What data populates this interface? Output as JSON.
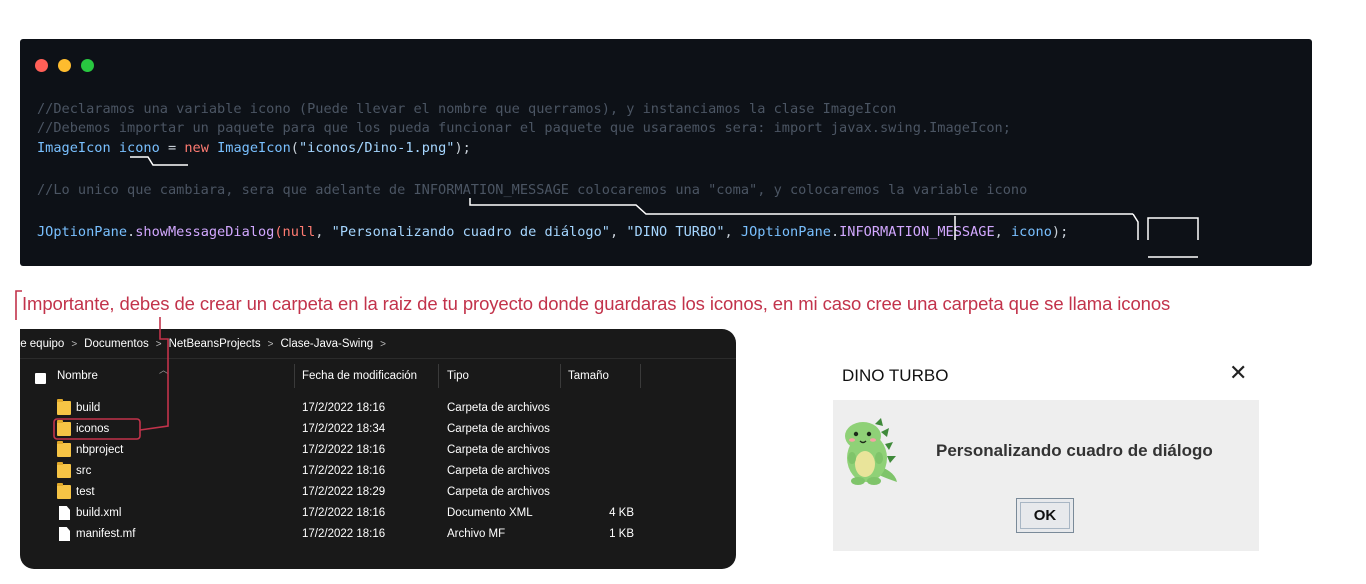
{
  "code": {
    "line1": "//Declaramos una variable icono (Puede llevar el nombre que querramos), y instanciamos la clase ImageIcon",
    "line2": "//Debemos importar un paquete para que los pueda funcionar el paquete que usaraemos sera: import javax.swing.ImageIcon;",
    "line3": {
      "type": "ImageIcon",
      "var": "icono",
      "eq": " = ",
      "kw": "new",
      "ctor": "ImageIcon",
      "open": "(",
      "arg": "\"iconos/Dino-1.png\"",
      "close": ");"
    },
    "line4": "//Lo unico que cambiara, sera que adelante de INFORMATION_MESSAGE colocaremos una \"coma\", y colocaremos la variable icono",
    "line5": {
      "cls": "JOptionPane",
      "dot1": ".",
      "method": "showMessageDialog",
      "open": "(",
      "nul": "null",
      "c1": ", ",
      "msg": "\"Personalizando cuadro de diálogo\"",
      "c2": ", ",
      "title": "\"DINO TURBO\"",
      "c3": ", ",
      "cls2": "JOptionPane",
      "dot2": ".",
      "constant": "INFORMATION_MESSAGE",
      "c4": ", ",
      "icon": "icono",
      "close": ");"
    }
  },
  "note": "Importante, debes de crear un carpeta en la raiz de tu proyecto donde guardaras los iconos, en mi caso cree una carpeta que se llama iconos",
  "explorer": {
    "breadcrumb": [
      "te equipo",
      "Documentos",
      "NetBeansProjects",
      "Clase-Java-Swing"
    ],
    "columns": {
      "name": "Nombre",
      "date": "Fecha de modificación",
      "type": "Tipo",
      "size": "Tamaño"
    },
    "rows": [
      {
        "name": "build",
        "date": "17/2/2022 18:16",
        "type": "Carpeta de archivos",
        "size": "",
        "kind": "folder"
      },
      {
        "name": "iconos",
        "date": "17/2/2022 18:34",
        "type": "Carpeta de archivos",
        "size": "",
        "kind": "folder"
      },
      {
        "name": "nbproject",
        "date": "17/2/2022 18:16",
        "type": "Carpeta de archivos",
        "size": "",
        "kind": "folder"
      },
      {
        "name": "src",
        "date": "17/2/2022 18:16",
        "type": "Carpeta de archivos",
        "size": "",
        "kind": "folder"
      },
      {
        "name": "test",
        "date": "17/2/2022 18:29",
        "type": "Carpeta de archivos",
        "size": "",
        "kind": "folder"
      },
      {
        "name": "build.xml",
        "date": "17/2/2022 18:16",
        "type": "Documento XML",
        "size": "4 KB",
        "kind": "file"
      },
      {
        "name": "manifest.mf",
        "date": "17/2/2022 18:16",
        "type": "Archivo MF",
        "size": "1 KB",
        "kind": "file"
      }
    ]
  },
  "dialog": {
    "title": "DINO TURBO",
    "close_glyph": "✕",
    "message": "Personalizando cuadro de diálogo",
    "ok_label": "OK",
    "icon": "dino-icon"
  },
  "colors": {
    "code_bg": "#0d1117",
    "annotation": "#c2334b",
    "folder": "#f6c445",
    "explorer_bg": "#191919",
    "dialog_bg": "#eeeeee"
  }
}
